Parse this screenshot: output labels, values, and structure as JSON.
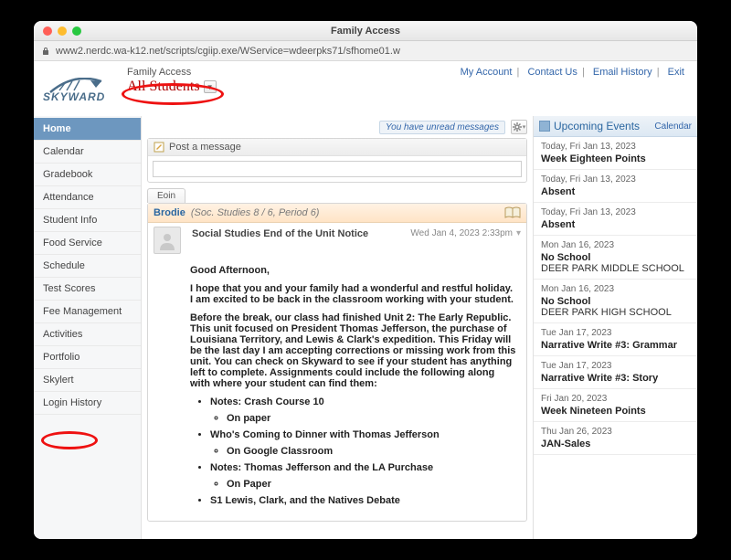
{
  "window": {
    "title": "Family Access"
  },
  "url": "www2.nerdc.wa-k12.net/scripts/cgiip.exe/WService=wdeerpks71/sfhome01.w",
  "header": {
    "logo_text": "SKYWARD",
    "fa_label": "Family Access",
    "student_selector": "All Students"
  },
  "toplinks": {
    "account": "My Account",
    "contact": "Contact Us",
    "email": "Email History",
    "exit": "Exit"
  },
  "sidebar": {
    "items": [
      "Home",
      "Calendar",
      "Gradebook",
      "Attendance",
      "Student Info",
      "Food Service",
      "Schedule",
      "Test Scores",
      "Fee Management",
      "Activities",
      "Portfolio",
      "Skylert",
      "Login History"
    ],
    "active": 0
  },
  "main": {
    "unread": "You have unread messages",
    "post_label": "Post a message",
    "tab": "Eoin",
    "msg": {
      "from_name": "Brodie",
      "from_meta": "(Soc. Studies 8 / 6, Period 6)",
      "title": "Social Studies End of the Unit Notice",
      "date": "Wed Jan 4, 2023 2:33pm",
      "p1": "Good Afternoon,",
      "p2": "I hope that you and your family had a wonderful and restful holiday. I am excited to be back in the classroom working with your student.",
      "p3": "Before the break, our class had finished Unit 2: The Early Republic. This unit focused on President Thomas Jefferson, the purchase of Louisiana Territory, and Lewis & Clark's expedition. This Friday will be the last day I am accepting corrections or missing work from this unit. You can check on Skyward to see if your student has anything left to complete. Assignments could include the following along with where your student can find them:",
      "bul": {
        "a": "Notes: Crash Course 10",
        "a1": "On paper",
        "b": "Who's Coming to Dinner with Thomas Jefferson",
        "b1": "On Google Classroom",
        "c": "Notes: Thomas Jefferson and the LA Purchase",
        "c1": "On Paper",
        "d": "S1 Lewis, Clark, and the Natives Debate"
      }
    }
  },
  "right": {
    "title": "Upcoming Events",
    "calendar_link": "Calendar",
    "events": [
      {
        "d": "Today, Fri Jan 13, 2023",
        "s": "Week Eighteen Points",
        "sub": ""
      },
      {
        "d": "Today, Fri Jan 13, 2023",
        "s": "Absent",
        "sub": ""
      },
      {
        "d": "Today, Fri Jan 13, 2023",
        "s": "Absent",
        "sub": ""
      },
      {
        "d": "Mon Jan 16, 2023",
        "s": "No School",
        "sub": "DEER PARK MIDDLE SCHOOL"
      },
      {
        "d": "Mon Jan 16, 2023",
        "s": "No School",
        "sub": "DEER PARK HIGH SCHOOL"
      },
      {
        "d": "Tue Jan 17, 2023",
        "s": "Narrative Write #3: Grammar",
        "sub": ""
      },
      {
        "d": "Tue Jan 17, 2023",
        "s": "Narrative Write #3: Story",
        "sub": ""
      },
      {
        "d": "Fri Jan 20, 2023",
        "s": "Week Nineteen Points",
        "sub": ""
      },
      {
        "d": "Thu Jan 26, 2023",
        "s": "JAN-Sales",
        "sub": ""
      }
    ]
  }
}
